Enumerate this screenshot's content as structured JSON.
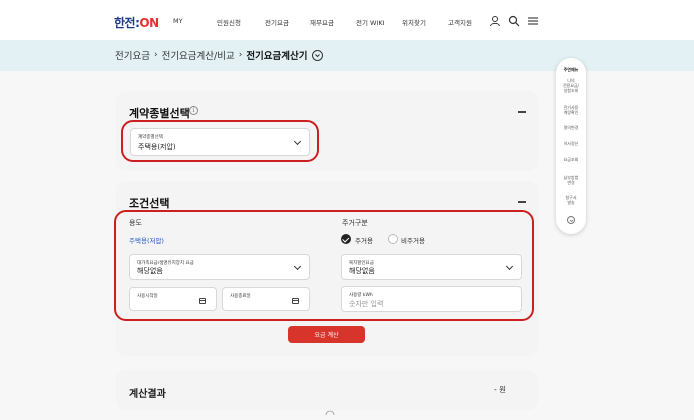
{
  "header": {
    "logo_part1": "한전:",
    "logo_part2": "ON",
    "nav": [
      "MY",
      "민원신청",
      "전기요금",
      "재무요금",
      "전기 WIKI",
      "위치찾기",
      "고객지원"
    ],
    "icons": [
      "user-icon",
      "search-icon",
      "menu-icon"
    ]
  },
  "breadcrumb": {
    "items": [
      "전기요금",
      "전기요금계산/비교"
    ],
    "current": "전기요금계산기"
  },
  "contract_section": {
    "title": "계약종별선택",
    "field_label": "계약종별선택",
    "field_value": "주택용(저압)"
  },
  "condition_section": {
    "title": "조건선택",
    "usage_label": "용도",
    "usage_value": "주택용(저압)",
    "discount_field": {
      "label": "대가족요금/생명유지장치 요금",
      "value": "해당없음"
    },
    "start_date": {
      "label": "사용시작일"
    },
    "end_date": {
      "label": "사용종료일"
    },
    "residence_label": "주거구분",
    "residence_options": [
      {
        "label": "주거용",
        "selected": true
      },
      {
        "label": "비주거용",
        "selected": false
      }
    ],
    "welfare_field": {
      "label": "복지할인요금",
      "value": "해당없음"
    },
    "usage_kwh": {
      "label": "사용량 kWh",
      "placeholder": "숫자만 입력"
    }
  },
  "calc_button": "요금 계산",
  "result_section": {
    "title": "계산결과",
    "value": "- 원"
  },
  "quick_menu": {
    "title": "주연메뉴",
    "items": [
      "나의\n전용요금/\n실험조회",
      "전기사용\n계량확인",
      "명의변경",
      "이사정산",
      "요금조회",
      "납부방법\n변경",
      "청구서\n발송"
    ]
  },
  "colors": {
    "highlight_red": "#cc1f1f",
    "button_red": "#d7342c",
    "band": "#e3f1f5",
    "link_blue": "#1f55c9"
  }
}
